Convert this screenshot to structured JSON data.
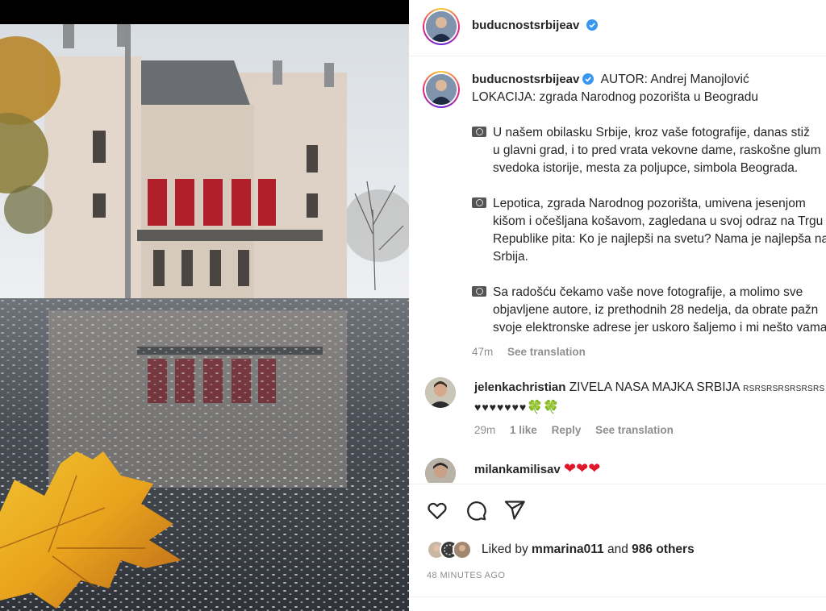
{
  "post": {
    "username": "buducnostsrbijeav",
    "verified": true
  },
  "caption": {
    "username": "buducnostsrbijeav",
    "lines": [
      "AUTOR: Andrej Manojlović",
      "LOKACIJA: zgrada Narodnog pozorišta u Beogradu"
    ],
    "paragraphs": [
      [
        "U našem obilasku Srbije, kroz vaše fotografije, danas stiž",
        "u glavni grad, i to pred vrata vekovne dame, raskošne glum",
        "svedoka istorije, mesta za poljupce, simbola Beograda."
      ],
      [
        "Lepotica, zgrada Narodnog pozorišta, umivena jesenjom",
        "kišom i očešljana košavom, zagledana u svoj odraz na Trgu",
        "Republike pita: Ko je najlepši na svetu? Nama je najlepša na",
        "Srbija."
      ],
      [
        "Sa radošću čekamo vaše nove fotografije, a molimo sve",
        "objavljene autore, iz prethodnih 28 nedelja, da obrate pažn",
        "svoje elektronske adrese jer uskoro šaljemo i mi nešto vama"
      ]
    ],
    "time": "47m",
    "see_translation": "See translation"
  },
  "comments": [
    {
      "username": "jelenkachristian",
      "text": "ZIVELA NASA MAJKA SRBIJA",
      "extra": "RSRSRSRSRSRSRS",
      "hearts": "♥♥♥♥♥♥♥",
      "clovers": "🍀🍀",
      "time": "29m",
      "likes": "1 like",
      "reply": "Reply",
      "see_translation": "See translation"
    },
    {
      "username": "milankamilisav",
      "hearts": "❤❤❤"
    }
  ],
  "actions": {
    "like_icon": "heart-icon",
    "comment_icon": "comment-icon",
    "share_icon": "share-icon"
  },
  "likes": {
    "prefix": "Liked by",
    "user": "mmarina011",
    "conjunction": "and",
    "others": "986 others"
  },
  "timestamp": "48 MINUTES AGO",
  "colors": {
    "verified": "#3897f0",
    "meta": "#8e8e8e",
    "text": "#262626",
    "heart_red": "#e0162b",
    "theatre_banner": "#b1202a"
  }
}
